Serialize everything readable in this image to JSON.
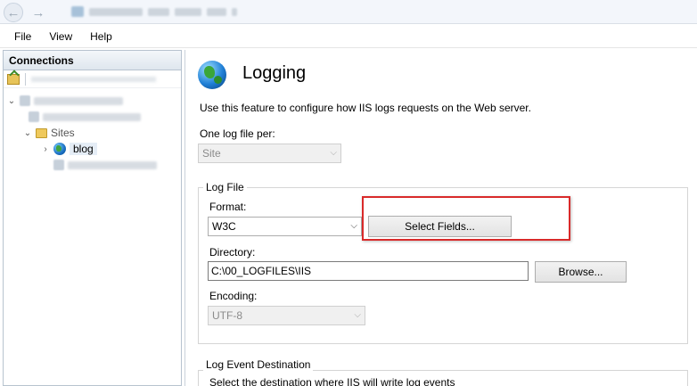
{
  "menu": {
    "file": "File",
    "view": "View",
    "help": "Help"
  },
  "connections": {
    "header": "Connections",
    "sites_label": "Sites",
    "site_name": "blog"
  },
  "feature": {
    "title": "Logging",
    "description": "Use this feature to configure how IIS logs requests on the Web server.",
    "one_log_label": "One log file per:",
    "one_log_value": "Site"
  },
  "log_file": {
    "group_title": "Log File",
    "format_label": "Format:",
    "format_value": "W3C",
    "select_fields_button": "Select Fields...",
    "directory_label": "Directory:",
    "directory_value": "C:\\00_LOGFILES\\IIS",
    "browse_button": "Browse...",
    "encoding_label": "Encoding:",
    "encoding_value": "UTF-8"
  },
  "log_event": {
    "group_title": "Log Event Destination",
    "description": "Select the destination where IIS will write log events"
  },
  "colors": {
    "highlight": "#d92a2a",
    "header_gradient_top": "#f4f7fa",
    "header_gradient_bottom": "#dfe6ee"
  }
}
